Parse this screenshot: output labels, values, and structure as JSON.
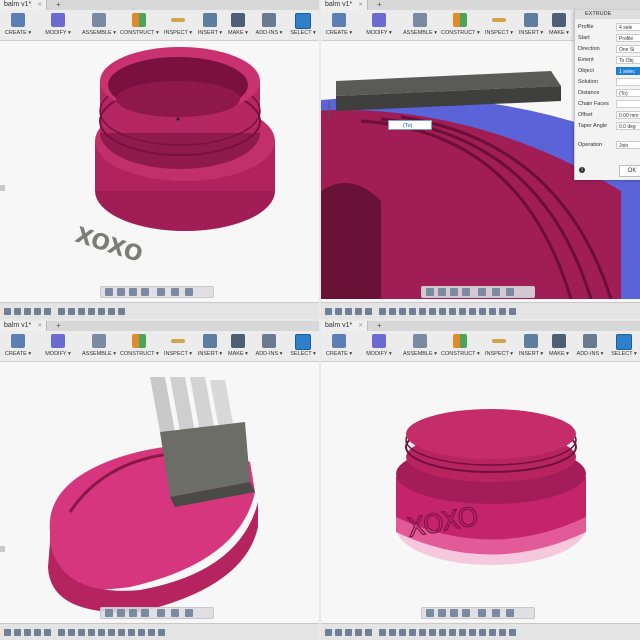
{
  "app": {
    "doc_tab": "balm v1*",
    "tab_close": "✕",
    "tab_add": "+"
  },
  "toolbar": {
    "items": [
      "CREATE ▾",
      "MODIFY ▾",
      "ASSEMBLE ▾",
      "CONSTRUCT ▾",
      "INSPECT ▾",
      "INSERT ▾",
      "MAKE ▾",
      "ADD-INS ▾",
      "SELECT ▾"
    ],
    "icons": [
      "create-icon",
      "modify-icon",
      "assemble-icon",
      "construct-icon",
      "inspect-icon",
      "insert-icon",
      "make-icon",
      "add-ins-icon",
      "select-icon"
    ],
    "colors": {
      "create": "#5b7fb5",
      "modify": "#6c6cd0",
      "assemble": "#7a8aa3",
      "construct": "#e08a2a",
      "inspect": "#cfa64a",
      "insert": "#5d7e9e",
      "make": "#4d5e75",
      "addins": "#6a7a90",
      "select": "#2f80c8"
    }
  },
  "viewport1": {
    "text": "XOXO"
  },
  "viewport4": {
    "text": "XOXO"
  },
  "extrude_panel": {
    "title": "EXTRUDE",
    "rows": [
      {
        "label": "Profile",
        "value": "4 sele"
      },
      {
        "label": "Start",
        "value": "Profile"
      },
      {
        "label": "Direction",
        "value": "One Si"
      },
      {
        "label": "Extent",
        "value": "To Obj"
      },
      {
        "label": "Object",
        "value": "1 selec"
      },
      {
        "label": "Solution",
        "value": ""
      },
      {
        "label": "Distance",
        "value": "(To)"
      },
      {
        "label": "Chain Faces",
        "value": ""
      },
      {
        "label": "Offset",
        "value": "0.00 mm"
      },
      {
        "label": "Taper Angle",
        "value": "0.0 deg"
      },
      {
        "label": "Operation",
        "value": "Join"
      }
    ],
    "ok": "OK",
    "info": "i"
  },
  "distance_tag": "(To)",
  "colors": {
    "magenta": "#b0235f",
    "dark_magenta": "#7a1040",
    "pink": "#d6367e",
    "gray_text": "#7d7d78",
    "blue_body": "#5b63d9"
  }
}
